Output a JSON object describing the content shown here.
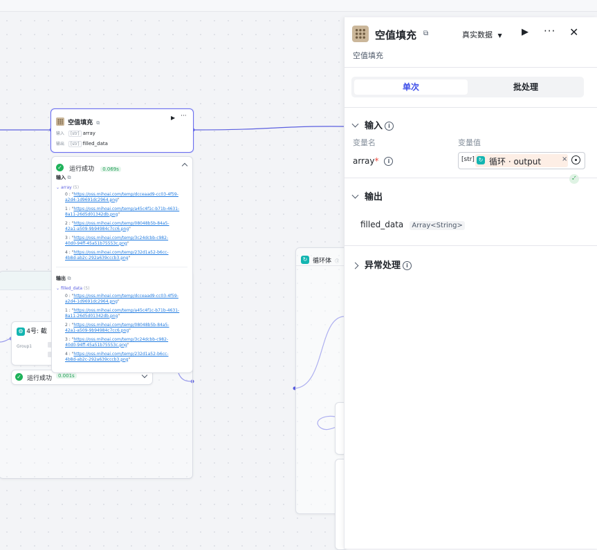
{
  "canvas": {
    "main_node": {
      "title": "空值填充",
      "in_label": "输入",
      "in_var": "array",
      "out_label": "输出",
      "out_var": "filled_data"
    },
    "result": {
      "status": "运行成功",
      "time": "0.069s",
      "input_title": "输入",
      "input_var": "array",
      "input_count": "(5)",
      "input_items": [
        {
          "idx": "0 : \"",
          "l1": "https://oss.mihoai.com/temp/dcceaad9-cc03-4f59-",
          "l2": "a2d4-1d9691dc2964.png"
        },
        {
          "idx": "1 : \"",
          "l1": "https://oss.mihoai.com/temp/a45c4f1c-b71b-4631-",
          "l2": "8a11-26d5d01342db.png"
        },
        {
          "idx": "2 : \"",
          "l1": "https://oss.mihoai.com/temp/08048b5b-84a5-",
          "l2": "42a1-a509-9b94984c7cc6.png"
        },
        {
          "idx": "3 : \"",
          "l1": "https://oss.mihoai.com/temp/3c24dcbb-c982-",
          "l2": "40d0-94ff-45a51b75553c.png"
        },
        {
          "idx": "4 : \"",
          "l1": "https://oss.mihoai.com/temp/232d1a52-b6cc-",
          "l2": "4b8d-ab2c-292a639cccb3.png"
        }
      ],
      "output_title": "输出",
      "output_var": "filled_data",
      "output_count": "(5)",
      "output_items": [
        {
          "idx": "0 : \"",
          "l1": "https://oss.mihoai.com/temp/dcceaad9-cc03-4f59-",
          "l2": "a2d4-1d9691dc2964.png"
        },
        {
          "idx": "1 : \"",
          "l1": "https://oss.mihoai.com/temp/a45c4f1c-b71b-4631-",
          "l2": "8a11-26d5d01342db.png"
        },
        {
          "idx": "2 : \"",
          "l1": "https://oss.mihoai.com/temp/08048b5b-84a5-",
          "l2": "42a1-a509-9b94984c7cc6.png"
        },
        {
          "idx": "3 : \"",
          "l1": "https://oss.mihoai.com/temp/3c24dcbb-c982-",
          "l2": "40d0-94ff-45a51b75553c.png"
        },
        {
          "idx": "4 : \"",
          "l1": "https://oss.mihoai.com/temp/232d1a52-b6cc-",
          "l2": "4b8d-ab2c-292a639cccb3.png"
        }
      ]
    },
    "node4": {
      "title": "4号: 截",
      "group": "Group1",
      "status": "运行成功",
      "time": "0.001s"
    },
    "loop_node": {
      "title": "循环体"
    }
  },
  "panel": {
    "title": "空值填充",
    "subtitle": "空值填充",
    "mode": "真实数据",
    "tab_single": "单次",
    "tab_batch": "批处理",
    "input_section": "输入",
    "col_name": "变量名",
    "col_value": "变量值",
    "param_name": "array",
    "type_tag": "[str]",
    "ref_text": "循环 · output",
    "output_section": "输出",
    "output_name": "filled_data",
    "output_type": "Array<String>",
    "error_section": "异常处理"
  },
  "colors": {
    "accent": "#3c4de8",
    "edge": "#5b5fe0",
    "success": "#1fb25a",
    "teal": "#13b5b1"
  }
}
